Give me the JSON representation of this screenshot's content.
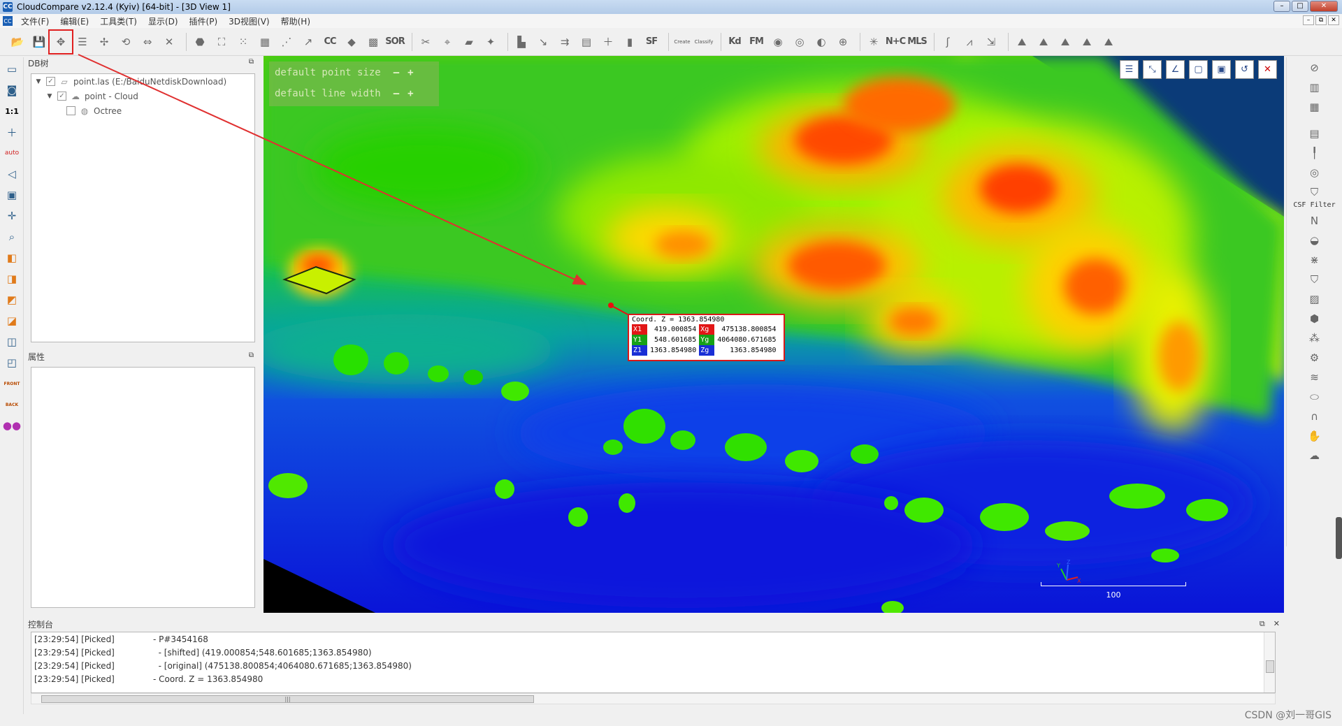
{
  "window": {
    "title": "CloudCompare v2.12.4 (Kyiv) [64-bit] - [3D View 1]",
    "min": "–",
    "max": "□",
    "close": "✕"
  },
  "menu": {
    "items": [
      "文件(F)",
      "编辑(E)",
      "工具类(T)",
      "显示(D)",
      "插件(P)",
      "3D视图(V)",
      "帮助(H)"
    ]
  },
  "mdi": {
    "min": "–",
    "restore": "⧉",
    "close": "✕"
  },
  "toolbar": {
    "sor_label": "SOR",
    "sf_label": "SF",
    "canupo_create": "Create",
    "canupo_classify": "Classify",
    "kd_label": "Kd",
    "fm_label": "FM",
    "nc_label": "N+C",
    "mls_label": "MLS",
    "cc_label": "CC"
  },
  "db_panel": {
    "title": "DB树",
    "items": [
      {
        "label": "point.las (E:/BaiduNetdiskDownload)",
        "checked": "✓"
      },
      {
        "label": "point - Cloud",
        "checked": "✓"
      },
      {
        "label": "Octree",
        "checked": ""
      }
    ]
  },
  "prop_panel": {
    "title": "属性"
  },
  "overlay": {
    "point_size": "default point size",
    "line_width": "default line width",
    "minus": "—",
    "plus": "+"
  },
  "pick_label": {
    "header": "Coord. Z = 1363.854980",
    "rows": [
      {
        "k1": "X1",
        "v1": "419.000854",
        "k2": "Xg",
        "v2": "475138.800854"
      },
      {
        "k1": "Y1",
        "v1": "548.601685",
        "k2": "Yg",
        "v2": "4064080.671685"
      },
      {
        "k1": "Z1",
        "v1": "1363.854980",
        "k2": "Zg",
        "v2": "1363.854980"
      }
    ]
  },
  "scale": {
    "label": "100"
  },
  "axes": {
    "x": "X",
    "y": "Y",
    "z": "Z"
  },
  "right_panel": {
    "csf_label": "CSF Filter",
    "n_label": "N"
  },
  "left_panel": {
    "ratio": "1:1",
    "auto": "auto",
    "front": "FRONT",
    "back": "BACK"
  },
  "console": {
    "title": "控制台",
    "lines": [
      {
        "time": "[23:29:54] [Picked]",
        "text": "- P#3454168"
      },
      {
        "time": "[23:29:54] [Picked]",
        "text": "  - [shifted] (419.000854;548.601685;1363.854980)"
      },
      {
        "time": "[23:29:54] [Picked]",
        "text": "  - [original] (475138.800854;4064080.671685;1363.854980)"
      },
      {
        "time": "[23:29:54] [Picked]",
        "text": "- Coord. Z = 1363.854980"
      }
    ],
    "hscroll_mark": "|||"
  },
  "watermark": "CSDN @刘一哥GIS",
  "colors": {
    "highlight": "#e02020",
    "terrain_high": "#e02010",
    "terrain_mid": "#c8f000",
    "terrain_low": "#0a20d8"
  }
}
